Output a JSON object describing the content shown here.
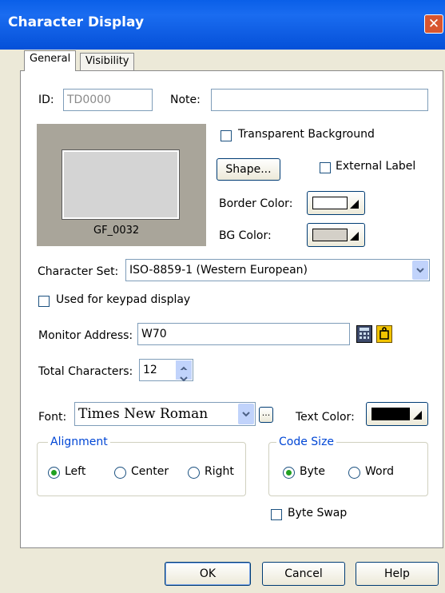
{
  "window": {
    "title": "Character Display",
    "close_glyph": "✕"
  },
  "tabs": [
    "General",
    "Visibility"
  ],
  "id": {
    "label": "ID:",
    "value": "TD0000"
  },
  "note": {
    "label": "Note:",
    "value": ""
  },
  "preview": {
    "caption": "GF_0032"
  },
  "transparent_bg": {
    "label": "Transparent Background",
    "checked": false
  },
  "shape_button": "Shape...",
  "external_label": {
    "label": "External Label",
    "checked": false
  },
  "border_color": {
    "label": "Border Color:",
    "color": "#ffffff"
  },
  "bg_color": {
    "label": "BG Color:",
    "color": "#d4d0c8"
  },
  "charset": {
    "label": "Character Set:",
    "value": "ISO-8859-1 (Western European)"
  },
  "keypad": {
    "label": "Used for keypad display",
    "checked": false
  },
  "monitor": {
    "label": "Monitor Address:",
    "value": "W70"
  },
  "total_chars": {
    "label": "Total Characters:",
    "value": "12"
  },
  "font": {
    "label": "Font:",
    "value": "Times New Roman",
    "more": "..."
  },
  "text_color": {
    "label": "Text Color:",
    "color": "#000000"
  },
  "alignment": {
    "legend": "Alignment",
    "options": [
      "Left",
      "Center",
      "Right"
    ],
    "selected": "Left"
  },
  "code_size": {
    "legend": "Code Size",
    "options": [
      "Byte",
      "Word"
    ],
    "selected": "Byte"
  },
  "byte_swap": {
    "label": "Byte Swap",
    "checked": false
  },
  "buttons": {
    "ok": "OK",
    "cancel": "Cancel",
    "help": "Help"
  }
}
